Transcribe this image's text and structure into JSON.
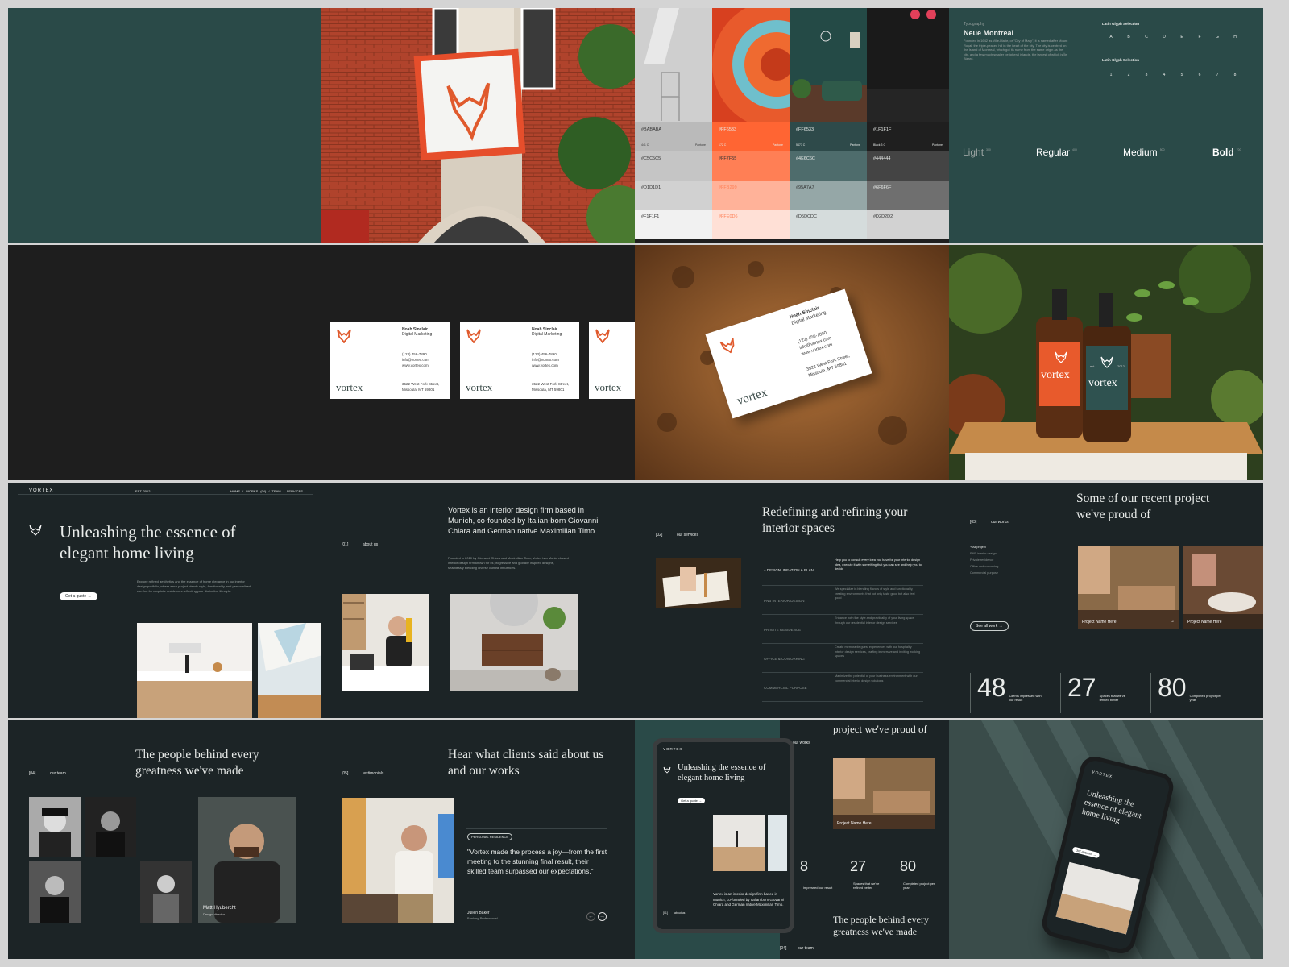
{
  "colors": {
    "teal": "#2a4a48",
    "dark": "#1e1e1e",
    "slide": "#1c2426",
    "accent": "#f2612c"
  },
  "palette": {
    "columns": [
      {
        "codes": [
          "#BABABA",
          "#C5C5C5",
          "#D1D1D1",
          "#F1F1F1"
        ],
        "pantone_left": "441 C",
        "pantone_right": "Pantone",
        "fills": [
          "#bababa",
          "#c5c5c5",
          "#d1d1d1",
          "#f1f1f1"
        ]
      },
      {
        "codes": [
          "#FF6533",
          "#FF7F55",
          "#FFB299",
          "#FFE0D6"
        ],
        "pantone_left": "172 C",
        "pantone_right": "Pantone",
        "fills": [
          "#ff6533",
          "#ff7f55",
          "#ffb299",
          "#ffe0d6"
        ]
      },
      {
        "codes": [
          "#FF6533",
          "#4E6C6C",
          "#95A7A7",
          "#D5DCDC"
        ],
        "pantone_left": "5477 C",
        "pantone_right": "Pantone",
        "fills": [
          "#2e4a4a",
          "#4e6c6c",
          "#95a7a7",
          "#d5dcdc"
        ]
      },
      {
        "codes": [
          "#1F1F1F",
          "#444444",
          "#6F6F6F",
          "#D2D2D2"
        ],
        "pantone_left": "Black 3 C",
        "pantone_right": "Pantone",
        "fills": [
          "#1f1f1f",
          "#444444",
          "#6f6f6f",
          "#d2d2d2"
        ]
      }
    ]
  },
  "typography": {
    "label": "Typography",
    "font_name": "Neue Montreal",
    "description": "Founded in 1642 as Ville-Marie, or \"City of Mary\", it is named after Mount Royal, the triple-peaked hill in the heart of the city. The city is centred on the Island of Montreal, which got its name from the same origin as the city, and a few much smaller peripheral islands, the largest of which is Île Bizard.",
    "glyph_title_1": "Latin Glyph Selection",
    "letters": [
      "A",
      "B",
      "C",
      "D",
      "E",
      "F",
      "G",
      "H"
    ],
    "glyph_title_2": "Latin Glyph Selection",
    "digits": [
      "1",
      "2",
      "3",
      "4",
      "5",
      "6",
      "7",
      "8"
    ],
    "weights": [
      {
        "name": "Light",
        "num": "300"
      },
      {
        "name": "Regular",
        "num": "400"
      },
      {
        "name": "Medium",
        "num": "500"
      },
      {
        "name": "Bold",
        "num": "700"
      }
    ]
  },
  "business_card": {
    "name": "Noah Sinclair",
    "title": "Digital Marketing",
    "phone": "(123) 456-7890",
    "email": "info@vortex.com",
    "web": "www.vortex.com",
    "address1": "3522 West Fork Street,",
    "address2": "Missoula, MT 59801",
    "brand": "vortex"
  },
  "bottles": {
    "brand": "vortex",
    "left": "est.",
    "right": "2012"
  },
  "hero": {
    "logo": "VORTEX",
    "est": "EST. 2012",
    "nav": [
      "HOME",
      "/",
      "WORKS",
      "(04)",
      "/",
      "TEAM",
      "/",
      "SERVICES"
    ],
    "title": "Unleashing the essence of elegant home living",
    "body": "Explore refined aesthetics and the essence of home elegance in our interior design portfolio, where each project blends style, functionality, and personalized comfort for exquisite residences reflecting your distinctive lifestyle.",
    "cta": "Get a quote"
  },
  "about": {
    "num": "[01]",
    "label": "about us",
    "heading": "Vortex is an interior design firm based in Munich, co-founded by Italian-born Giovanni Chiara and German native Maximilian Timo.",
    "body": "Founded in 2010 by Giovanni Chiara and Maximilian Timo, Vortex is a Munich-based interior design firm known for its progressive and globally inspired designs, seamlessly blending diverse cultural influences."
  },
  "services": {
    "num": "[02]",
    "label": "our services",
    "heading": "Redefining and refining your interior spaces",
    "items": [
      {
        "name": "+ DESIGN, IDEATION & PLAN",
        "desc": "Help you to consult every idea you have for your interior design idea, execute it with something that you can see and help you to decide"
      },
      {
        "name": "PNB INTERIOR DESIGN",
        "desc": "We specialize in blending flavors of style and functionality, creating environments that not only taste good but also feel good"
      },
      {
        "name": "PRIVATE RESIDENCE",
        "desc": "Enhance both the style and practicality of your living space through our residential interior design services"
      },
      {
        "name": "OFFICE & COWORKING",
        "desc": "Create memorable guest experiences with our hospitality interior design services, crafting immersive and inviting working spaces"
      },
      {
        "name": "COMMERCIAL PURPOSE",
        "desc": "Maximize the potential of your business environment with our commercial interior design solutions"
      }
    ]
  },
  "works": {
    "num": "[03]",
    "label": "our works",
    "heading": "Some of our recent project we've proud of",
    "filters": [
      "+ All project",
      "PNB interior design",
      "Private residence",
      "Office and coworking",
      "Commercial purpose"
    ],
    "see_all": "See all work",
    "project1": "Project Name Here",
    "project2": "Project Name Here",
    "stats": [
      {
        "num": "48",
        "label": "Clients impressed with our result"
      },
      {
        "num": "27",
        "label": "Spaces that we've refined better"
      },
      {
        "num": "80",
        "label": "Completed project per year"
      }
    ]
  },
  "team": {
    "num": "[04]",
    "label": "our team",
    "heading": "The people behind every greatness we've made",
    "person_name": "Matt Hyubercht",
    "person_role": "Design director"
  },
  "testimonials": {
    "num": "[05]",
    "label": "testimonials",
    "heading": "Hear what clients said about us and our works",
    "tag": "PERSONAL RESIDENCE",
    "quote": "\"Vortex made the process a joy—from the first meeting to the stunning final result, their skilled team surpassed our expectations.\"",
    "client": "Julien Baker",
    "client_role": "Banking Professional"
  },
  "tablet": {
    "logo": "VORTEX",
    "title": "Unleashing the essence of elegant home living",
    "cta": "Get a quote",
    "about": "Vortex is an interior design firm based in Munich, co-founded by Italian-born Giovanni Chiara and German native Maximilian Timo.",
    "about_num": "[01]",
    "about_label": "about us",
    "side_heading": "project we've proud of",
    "side_label": "our works",
    "project": "Project Name Here",
    "stats": [
      {
        "num": "8",
        "label": "impressed our result"
      },
      {
        "num": "27",
        "label": "Spaces that we've refined better"
      },
      {
        "num": "80",
        "label": "Completed project per year"
      }
    ],
    "team_heading": "The people behind every greatness we've made",
    "team_num": "[04]",
    "team_label": "our team"
  },
  "phone": {
    "logo": "VORTEX",
    "title": "Unleashing the essence of elegant home living",
    "cta": "Get a quote"
  }
}
